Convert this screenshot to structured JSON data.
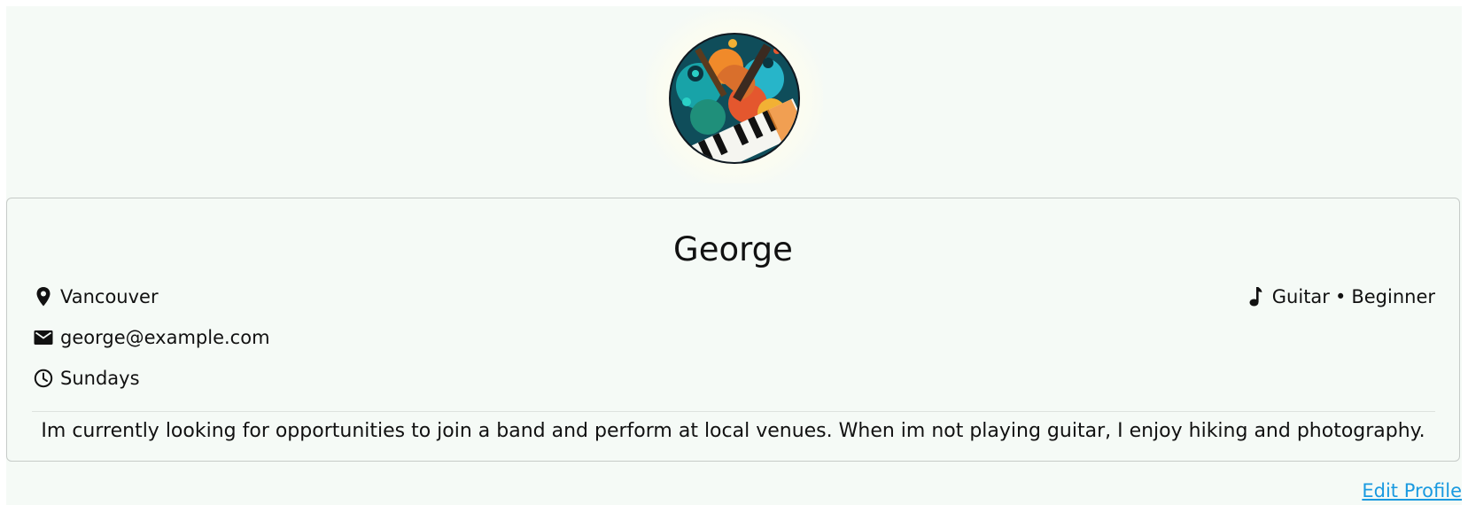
{
  "profile": {
    "name": "George",
    "location": "Vancouver",
    "email": "george@example.com",
    "availability": "Sundays",
    "instrument": "Guitar",
    "separator": "•",
    "skill_level": "Beginner",
    "bio": "Im currently looking for opportunities to join a band and perform at local venues. When im not playing guitar, I enjoy hiking and photography."
  },
  "icons": {
    "avatar": "music-collage-avatar",
    "location": "map-pin-icon",
    "email": "envelope-icon",
    "availability": "clock-icon",
    "instrument": "music-note-icon"
  },
  "actions": {
    "edit_profile_label": "Edit Profile"
  },
  "colors": {
    "page_background": "#f5faf6",
    "card_border": "#c6cbc8",
    "link": "#1a9ae0",
    "text": "#111111"
  }
}
